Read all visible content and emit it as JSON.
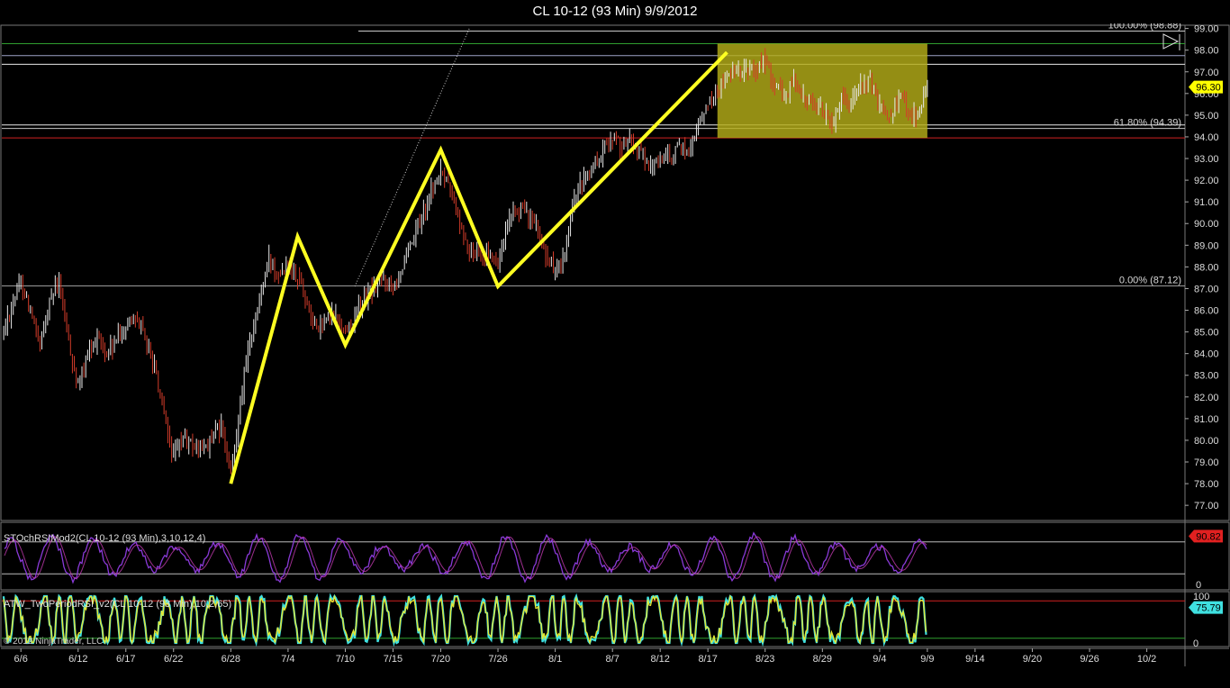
{
  "window": {
    "title": "CL 10-12 (93 Min)  9/9/2012"
  },
  "chart_data": [
    {
      "type": "line",
      "name": "price_panel",
      "xlim_date": [
        "2012-06-04",
        "2012-10-06"
      ],
      "ylim": [
        76.3,
        99.15
      ],
      "ticks_y": [
        77,
        78,
        79,
        80,
        81,
        82,
        83,
        84,
        85,
        86,
        87,
        88,
        89,
        90,
        91,
        92,
        93,
        94,
        95,
        96,
        97,
        98,
        99
      ],
      "tick_labels_y": [
        "77.00",
        "78.00",
        "79.00",
        "80.00",
        "81.00",
        "82.00",
        "83.00",
        "84.00",
        "85.00",
        "86.00",
        "87.00",
        "88.00",
        "89.00",
        "90.00",
        "91.00",
        "92.00",
        "93.00",
        "94.00",
        "95.00",
        "96.00",
        "97.00",
        "98.00",
        "99.00"
      ],
      "x_ticks": [
        {
          "date": "2012-06-06",
          "label": "6/6"
        },
        {
          "date": "2012-06-12",
          "label": "6/12"
        },
        {
          "date": "2012-06-17",
          "label": "6/17"
        },
        {
          "date": "2012-06-22",
          "label": "6/22"
        },
        {
          "date": "2012-06-28",
          "label": "6/28"
        },
        {
          "date": "2012-07-04",
          "label": "7/4"
        },
        {
          "date": "2012-07-10",
          "label": "7/10"
        },
        {
          "date": "2012-07-15",
          "label": "7/15"
        },
        {
          "date": "2012-07-20",
          "label": "7/20"
        },
        {
          "date": "2012-07-26",
          "label": "7/26"
        },
        {
          "date": "2012-08-01",
          "label": "8/1"
        },
        {
          "date": "2012-08-07",
          "label": "8/7"
        },
        {
          "date": "2012-08-12",
          "label": "8/12"
        },
        {
          "date": "2012-08-17",
          "label": "8/17"
        },
        {
          "date": "2012-08-23",
          "label": "8/23"
        },
        {
          "date": "2012-08-29",
          "label": "8/29"
        },
        {
          "date": "2012-09-04",
          "label": "9/4"
        },
        {
          "date": "2012-09-09",
          "label": "9/9"
        },
        {
          "date": "2012-09-14",
          "label": "9/14"
        },
        {
          "date": "2012-09-20",
          "label": "9/20"
        },
        {
          "date": "2012-09-26",
          "label": "9/26"
        },
        {
          "date": "2012-10-02",
          "label": "10/2"
        }
      ],
      "series": [
        {
          "values": [
            {
              "x": "2012-06-04",
              "y": 84.8
            },
            {
              "x": "2012-06-05",
              "y": 86.2
            },
            {
              "x": "2012-06-06",
              "y": 87.4
            },
            {
              "x": "2012-06-07",
              "y": 86.0
            },
            {
              "x": "2012-06-08",
              "y": 84.2
            },
            {
              "x": "2012-06-09",
              "y": 86.5
            },
            {
              "x": "2012-06-10",
              "y": 87.3
            },
            {
              "x": "2012-06-11",
              "y": 84.6
            },
            {
              "x": "2012-06-12",
              "y": 82.4
            },
            {
              "x": "2012-06-13",
              "y": 83.8
            },
            {
              "x": "2012-06-14",
              "y": 84.9
            },
            {
              "x": "2012-06-15",
              "y": 83.9
            },
            {
              "x": "2012-06-16",
              "y": 84.6
            },
            {
              "x": "2012-06-17",
              "y": 85.2
            },
            {
              "x": "2012-06-18",
              "y": 85.9
            },
            {
              "x": "2012-06-19",
              "y": 84.6
            },
            {
              "x": "2012-06-20",
              "y": 83.4
            },
            {
              "x": "2012-06-21",
              "y": 81.0
            },
            {
              "x": "2012-06-22",
              "y": 79.2
            },
            {
              "x": "2012-06-23",
              "y": 80.1
            },
            {
              "x": "2012-06-24",
              "y": 79.7
            },
            {
              "x": "2012-06-25",
              "y": 79.5
            },
            {
              "x": "2012-06-26",
              "y": 80.1
            },
            {
              "x": "2012-06-27",
              "y": 80.6
            },
            {
              "x": "2012-06-28",
              "y": 78.3
            },
            {
              "x": "2012-06-29",
              "y": 81.8
            },
            {
              "x": "2012-06-30",
              "y": 84.6
            },
            {
              "x": "2012-07-01",
              "y": 86.4
            },
            {
              "x": "2012-07-02",
              "y": 88.4
            },
            {
              "x": "2012-07-03",
              "y": 87.8
            },
            {
              "x": "2012-07-04",
              "y": 88.2
            },
            {
              "x": "2012-07-05",
              "y": 87.6
            },
            {
              "x": "2012-07-06",
              "y": 86.4
            },
            {
              "x": "2012-07-07",
              "y": 85.1
            },
            {
              "x": "2012-07-08",
              "y": 85.6
            },
            {
              "x": "2012-07-09",
              "y": 85.8
            },
            {
              "x": "2012-07-10",
              "y": 85.0
            },
            {
              "x": "2012-07-11",
              "y": 85.7
            },
            {
              "x": "2012-07-12",
              "y": 86.6
            },
            {
              "x": "2012-07-13",
              "y": 87.0
            },
            {
              "x": "2012-07-14",
              "y": 87.5
            },
            {
              "x": "2012-07-15",
              "y": 87.2
            },
            {
              "x": "2012-07-16",
              "y": 88.0
            },
            {
              "x": "2012-07-17",
              "y": 89.0
            },
            {
              "x": "2012-07-18",
              "y": 90.3
            },
            {
              "x": "2012-07-19",
              "y": 91.5
            },
            {
              "x": "2012-07-20",
              "y": 92.4
            },
            {
              "x": "2012-07-21",
              "y": 91.6
            },
            {
              "x": "2012-07-22",
              "y": 90.0
            },
            {
              "x": "2012-07-23",
              "y": 88.6
            },
            {
              "x": "2012-07-24",
              "y": 88.9
            },
            {
              "x": "2012-07-25",
              "y": 88.4
            },
            {
              "x": "2012-07-26",
              "y": 88.1
            },
            {
              "x": "2012-07-27",
              "y": 89.8
            },
            {
              "x": "2012-07-28",
              "y": 90.7
            },
            {
              "x": "2012-07-29",
              "y": 90.4
            },
            {
              "x": "2012-07-30",
              "y": 89.9
            },
            {
              "x": "2012-07-31",
              "y": 88.6
            },
            {
              "x": "2012-08-01",
              "y": 87.8
            },
            {
              "x": "2012-08-02",
              "y": 88.4
            },
            {
              "x": "2012-08-03",
              "y": 91.2
            },
            {
              "x": "2012-08-04",
              "y": 92.0
            },
            {
              "x": "2012-08-05",
              "y": 92.6
            },
            {
              "x": "2012-08-06",
              "y": 93.4
            },
            {
              "x": "2012-08-07",
              "y": 94.0
            },
            {
              "x": "2012-08-08",
              "y": 93.6
            },
            {
              "x": "2012-08-09",
              "y": 93.9
            },
            {
              "x": "2012-08-10",
              "y": 93.1
            },
            {
              "x": "2012-08-11",
              "y": 92.5
            },
            {
              "x": "2012-08-12",
              "y": 93.1
            },
            {
              "x": "2012-08-13",
              "y": 92.9
            },
            {
              "x": "2012-08-14",
              "y": 93.6
            },
            {
              "x": "2012-08-15",
              "y": 93.3
            },
            {
              "x": "2012-08-16",
              "y": 94.6
            },
            {
              "x": "2012-08-17",
              "y": 95.5
            },
            {
              "x": "2012-08-18",
              "y": 96.1
            },
            {
              "x": "2012-08-19",
              "y": 96.8
            },
            {
              "x": "2012-08-20",
              "y": 96.9
            },
            {
              "x": "2012-08-21",
              "y": 97.2
            },
            {
              "x": "2012-08-22",
              "y": 97.1
            },
            {
              "x": "2012-08-23",
              "y": 97.6
            },
            {
              "x": "2012-08-24",
              "y": 96.3
            },
            {
              "x": "2012-08-25",
              "y": 95.9
            },
            {
              "x": "2012-08-26",
              "y": 96.7
            },
            {
              "x": "2012-08-27",
              "y": 95.8
            },
            {
              "x": "2012-08-28",
              "y": 95.6
            },
            {
              "x": "2012-08-29",
              "y": 95.2
            },
            {
              "x": "2012-08-30",
              "y": 94.6
            },
            {
              "x": "2012-08-31",
              "y": 95.9
            },
            {
              "x": "2012-09-01",
              "y": 95.7
            },
            {
              "x": "2012-09-02",
              "y": 96.3
            },
            {
              "x": "2012-09-03",
              "y": 96.6
            },
            {
              "x": "2012-09-04",
              "y": 95.4
            },
            {
              "x": "2012-09-05",
              "y": 95.0
            },
            {
              "x": "2012-09-06",
              "y": 95.9
            },
            {
              "x": "2012-09-07",
              "y": 95.2
            },
            {
              "x": "2012-09-08",
              "y": 95.0
            },
            {
              "x": "2012-09-09",
              "y": 96.3
            }
          ]
        }
      ],
      "drawn_zigzag": [
        {
          "x": "2012-06-28",
          "y": 78.0
        },
        {
          "x": "2012-07-05",
          "y": 89.4
        },
        {
          "x": "2012-07-10",
          "y": 84.4
        },
        {
          "x": "2012-07-20",
          "y": 93.4
        },
        {
          "x": "2012-07-26",
          "y": 87.1
        },
        {
          "x": "2012-08-19",
          "y": 97.9
        }
      ],
      "horizontal_lines": [
        {
          "y": 98.88,
          "color": "#c8c8c8"
        },
        {
          "y": 98.3,
          "color": "#2e9e2e"
        },
        {
          "y": 97.75,
          "color": "#9ea3c8"
        },
        {
          "y": 97.35,
          "color": "#e8e8e8"
        },
        {
          "y": 94.55,
          "color": "#e8e8e8"
        },
        {
          "y": 94.39,
          "color": "#c8c8c8"
        },
        {
          "y": 93.95,
          "color": "#d02020"
        },
        {
          "y": 87.12,
          "color": "#9a9a9a"
        }
      ],
      "fib_labels": [
        {
          "text": "100.00% (98.88)",
          "y": 98.88
        },
        {
          "text": "61.80% (94.39)",
          "y": 94.39
        },
        {
          "text": "0.00% (87.12)",
          "y": 87.12
        }
      ],
      "box": {
        "x0": "2012-08-18",
        "x1": "2012-09-09",
        "y0": 93.95,
        "y1": 98.3,
        "color": "#b4ad19"
      },
      "trendline": {
        "from": {
          "x": "2012-07-11",
          "y": 87.1
        },
        "to": {
          "x": "2012-07-23",
          "y": 99.0
        }
      },
      "last_price": {
        "label": "96.30",
        "y": 96.3,
        "color": "#ffff00"
      }
    },
    {
      "type": "line",
      "name": "stoch_rsi_panel",
      "title": "STOchRSIMod2(CL 10-12 (93 Min),3,10,12,4)",
      "ylim": [
        0,
        100
      ],
      "levels": [
        80,
        20
      ],
      "tick_labels_y": [
        {
          "y": 0,
          "label": "0"
        }
      ],
      "last_value": {
        "label": "90.82",
        "y": 90.82,
        "color": "#e02020"
      },
      "line_color": "#8a3ad8"
    },
    {
      "type": "line",
      "name": "rsi_panel",
      "title": "ATW_TwoPeriodRSI_v2(CL 10-12 (93 Min),10,2,65)",
      "ylim": [
        0,
        100
      ],
      "levels": [
        90,
        10
      ],
      "tick_labels_y": [
        {
          "y": 100,
          "label": "100"
        },
        {
          "y": 0,
          "label": "0"
        }
      ],
      "last_value": {
        "label": "75.79",
        "y": 75.79,
        "color": "#3fe0e0"
      },
      "line_color": "#e8e830"
    }
  ],
  "footer": {
    "copyright": "© 2012 NinjaTrader, LLC"
  },
  "colors": {
    "background": "#000000",
    "up_bar": "#e8e8e8",
    "down_bar": "#d43c2a",
    "zigzag": "#ffff22",
    "axis_text": "#dcdcdc"
  }
}
